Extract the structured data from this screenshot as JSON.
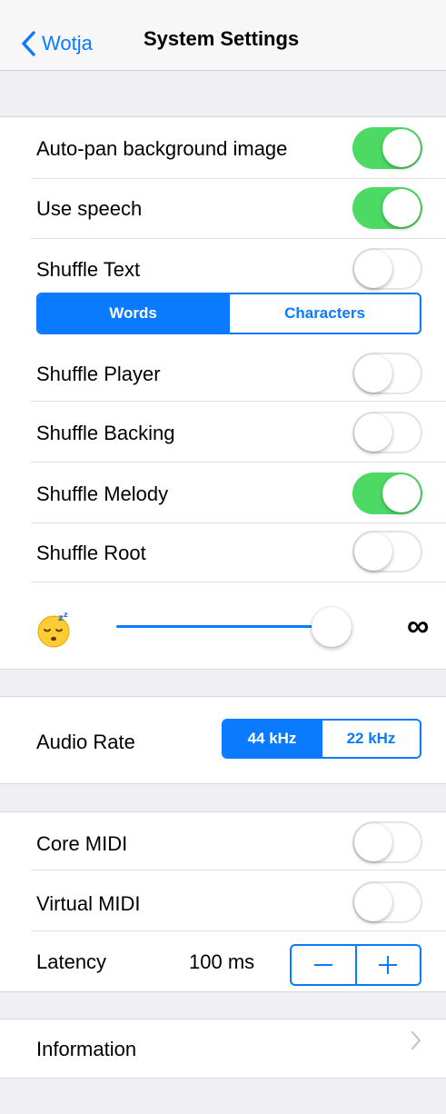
{
  "nav": {
    "back_label": "Wotja",
    "title": "System Settings"
  },
  "toggles": [
    {
      "label": "Auto-pan background image",
      "on": true
    },
    {
      "label": "Use speech",
      "on": true
    },
    {
      "label": "Shuffle Text",
      "on": false
    },
    {
      "label": "Shuffle Player",
      "on": false
    },
    {
      "label": "Shuffle Backing",
      "on": false
    },
    {
      "label": "Shuffle Melody",
      "on": true
    },
    {
      "label": "Shuffle Root",
      "on": false
    }
  ],
  "shuffle_text_mode": {
    "options": [
      "Words",
      "Characters"
    ],
    "selected": "Words"
  },
  "sleep_slider": {
    "min_icon": "sleepy-face-icon",
    "max_symbol": "∞",
    "value_fraction": 0.92
  },
  "audio_rate": {
    "label": "Audio Rate",
    "options": [
      "44 kHz",
      "22 kHz"
    ],
    "selected": "44 kHz"
  },
  "midi": {
    "core_midi": {
      "label": "Core MIDI",
      "on": false
    },
    "virtual_midi": {
      "label": "Virtual MIDI",
      "on": false
    },
    "latency_label": "Latency",
    "latency_value": "100 ms",
    "minus_icon": "minus-icon",
    "plus_icon": "plus-icon"
  },
  "information": {
    "label": "Information",
    "chevron_icon": "chevron-right-icon"
  },
  "colors": {
    "accent": "#0a7aff",
    "toggle_on": "#4cd964",
    "background": "#efeff4",
    "slider_track": "#0a7aff"
  }
}
